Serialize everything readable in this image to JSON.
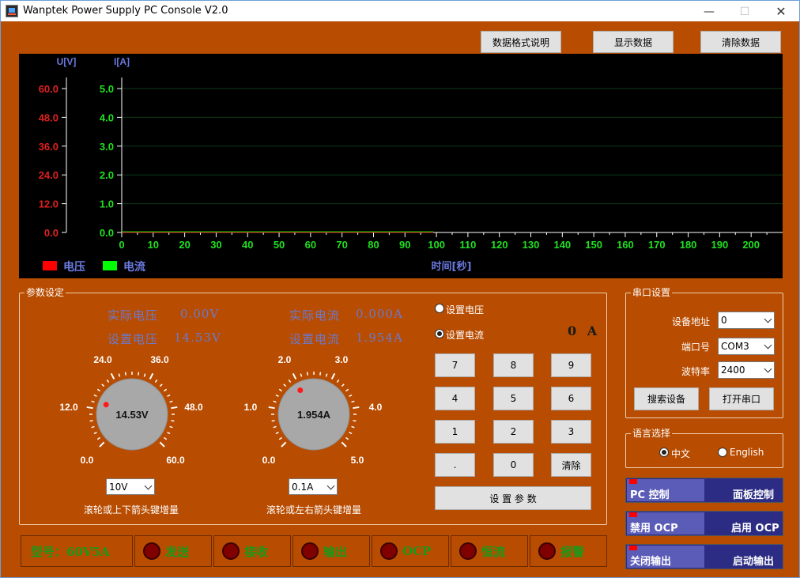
{
  "window": {
    "title": "Wanptek Power Supply PC Console V2.0"
  },
  "toolbar": {
    "format_label": "数据格式说明",
    "show_label": "显示数据",
    "clear_label": "清除数据"
  },
  "chart_data": {
    "type": "line",
    "ylabel_v": "U[V]",
    "ylabel_i": "I[A]",
    "xlabel": "时间[秒]",
    "v_ticks": [
      "60.0",
      "48.0",
      "36.0",
      "24.0",
      "12.0",
      "0.0"
    ],
    "i_ticks": [
      "5.0",
      "4.0",
      "3.0",
      "2.0",
      "1.0",
      "0.0"
    ],
    "x_ticks": [
      0,
      10,
      20,
      30,
      40,
      50,
      60,
      70,
      80,
      90,
      100,
      110,
      120,
      130,
      140,
      150,
      160,
      170,
      180,
      190,
      200
    ],
    "xlim": [
      0,
      210
    ],
    "ylim_v": [
      0,
      60
    ],
    "ylim_i": [
      0,
      5
    ],
    "series": [
      {
        "name": "电压",
        "color": "#ff0000",
        "x": [
          0,
          99
        ],
        "y": [
          0,
          0
        ]
      },
      {
        "name": "电流",
        "color": "#00ff00",
        "x": [
          0,
          99
        ],
        "y": [
          0,
          0
        ]
      }
    ],
    "grid": true,
    "legend": "bottom-left"
  },
  "params": {
    "title": "参数设定",
    "actual_voltage_label": "实际电压",
    "actual_voltage_value": "0.00V",
    "set_voltage_label": "设置电压",
    "set_voltage_value": "14.53V",
    "actual_current_label": "实际电流",
    "actual_current_value": "0.000A",
    "set_current_label": "设置电流",
    "set_current_value": "1.954A",
    "vknob": {
      "labels": [
        "0.0",
        "12.0",
        "24.0",
        "36.0",
        "48.0",
        "60.0"
      ],
      "value_text": "14.53V",
      "value": 14.53,
      "max": 60
    },
    "iknob": {
      "labels": [
        "0.0",
        "1.0",
        "2.0",
        "3.0",
        "4.0",
        "5.0"
      ],
      "value_text": "1.954A",
      "value": 1.954,
      "max": 5
    },
    "v_step": "10V",
    "i_step": "0.1A",
    "v_hint": "滚轮或上下箭头键增量",
    "i_hint": "滚轮或左右箭头键增量",
    "radio_voltage": "设置电压",
    "radio_current": "设置电流",
    "keypad_display": "0 A",
    "keys": [
      "7",
      "8",
      "9",
      "4",
      "5",
      "6",
      "1",
      "2",
      "3",
      ".",
      "0",
      "清除"
    ],
    "set_button": "设 置 参 数"
  },
  "serial": {
    "title": "串口设置",
    "addr_label": "设备地址",
    "addr_value": "0",
    "port_label": "端口号",
    "port_value": "COM3",
    "baud_label": "波特率",
    "baud_value": "2400",
    "search_button": "搜索设备",
    "open_button": "打开串口"
  },
  "language": {
    "title": "语言选择",
    "chinese": "中文",
    "english": "English"
  },
  "toggles": [
    {
      "left": "PC 控制",
      "right": "面板控制"
    },
    {
      "left": "禁用 OCP",
      "right": "启用 OCP"
    },
    {
      "left": "关闭输出",
      "right": "启动输出"
    }
  ],
  "status": {
    "model": "型号：60V5A",
    "send": "发送",
    "receive": "接收",
    "output": "输出",
    "ocp": "OCP",
    "cc": "恒流",
    "alarm": "报警"
  }
}
